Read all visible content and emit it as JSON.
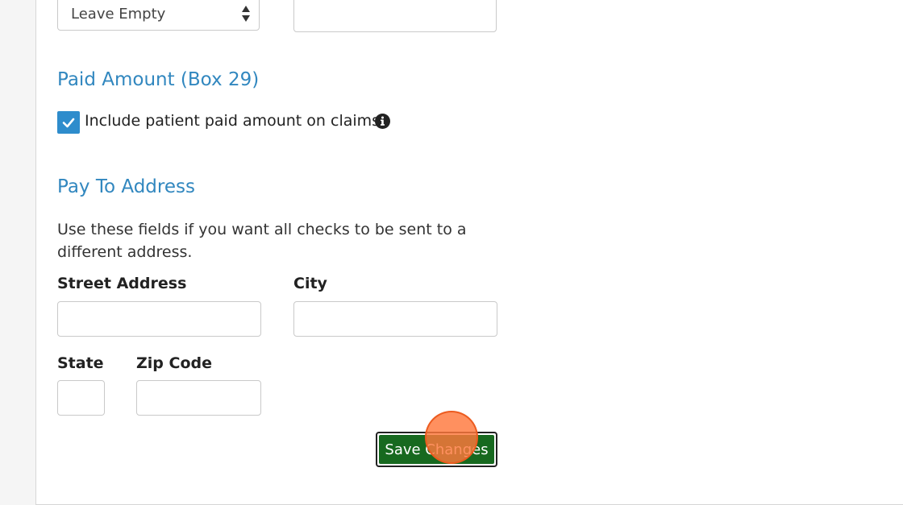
{
  "filing": {
    "select_value": "Leave Empty",
    "right_input_value": ""
  },
  "paid_amount": {
    "title": "Paid Amount (Box 29)",
    "checkbox_label": "Include patient paid amount on claims",
    "checked": true,
    "info_icon": "info-circle-icon"
  },
  "pay_to": {
    "title": "Pay To Address",
    "description": "Use these fields if you want all checks to be sent to a different address.",
    "street_label": "Street Address",
    "street_value": "",
    "city_label": "City",
    "city_value": "",
    "state_label": "State",
    "state_value": "",
    "zip_label": "Zip Code",
    "zip_value": ""
  },
  "actions": {
    "save_label": "Save Changes"
  },
  "colors": {
    "accent": "#3187bf",
    "checkbox": "#2e8ccc",
    "save_button": "#17691f",
    "click_marker": "#ff783c"
  }
}
